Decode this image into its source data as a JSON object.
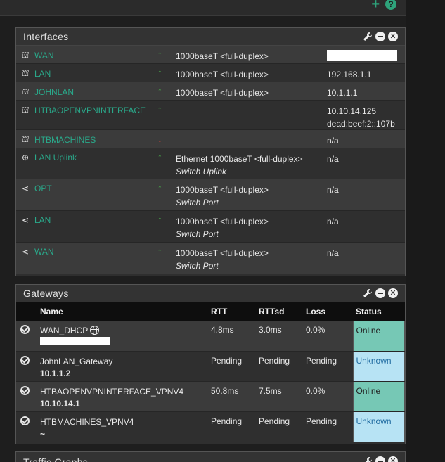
{
  "interfaces": {
    "title": "Interfaces",
    "rows": [
      {
        "name": "WAN",
        "icon": "network-icon",
        "status": "up",
        "media": "1000baseT <full-duplex>",
        "media_sub": "",
        "ip": "",
        "ip2": "",
        "ip_redacted": true
      },
      {
        "name": "LAN",
        "icon": "network-icon",
        "status": "up",
        "media": "1000baseT <full-duplex>",
        "media_sub": "",
        "ip": "192.168.1.1",
        "ip2": ""
      },
      {
        "name": "JOHNLAN",
        "icon": "network-icon",
        "status": "up",
        "media": "1000baseT <full-duplex>",
        "media_sub": "",
        "ip": "10.1.1.1",
        "ip2": ""
      },
      {
        "name": "HTBAOPENVPNINTERFACE",
        "icon": "network-icon",
        "status": "up",
        "media": "",
        "media_sub": "",
        "ip": "10.10.14.125",
        "ip2": "dead:beef:2::107b"
      },
      {
        "name": "HTBMACHINES",
        "icon": "network-icon",
        "status": "down",
        "media": "",
        "media_sub": "",
        "ip": "n/a",
        "ip2": ""
      },
      {
        "name": "LAN Uplink",
        "icon": "crosshair-icon",
        "status": "up",
        "media": "Ethernet 1000baseT <full-duplex>",
        "media_sub": "Switch Uplink",
        "ip": "n/a",
        "ip2": ""
      },
      {
        "name": "OPT",
        "icon": "share-icon",
        "status": "up",
        "media": "1000baseT <full-duplex>",
        "media_sub": "Switch Port",
        "ip": "n/a",
        "ip2": ""
      },
      {
        "name": "LAN",
        "icon": "share-icon",
        "status": "up",
        "media": "1000baseT <full-duplex>",
        "media_sub": "Switch Port",
        "ip": "n/a",
        "ip2": ""
      },
      {
        "name": "WAN",
        "icon": "share-icon",
        "status": "up",
        "media": "1000baseT <full-duplex>",
        "media_sub": "Switch Port",
        "ip": "n/a",
        "ip2": ""
      }
    ]
  },
  "gateways": {
    "title": "Gateways",
    "headers": {
      "name": "Name",
      "rtt": "RTT",
      "rttsd": "RTTsd",
      "loss": "Loss",
      "status": "Status"
    },
    "rows": [
      {
        "name": "WAN_DHCP",
        "sub": "",
        "rtt": "4.8ms",
        "rttsd": "3.0ms",
        "loss": "0.0%",
        "status": "Online"
      },
      {
        "name": "JohnLAN_Gateway",
        "sub": "10.1.1.2",
        "rtt": "Pending",
        "rttsd": "Pending",
        "loss": "Pending",
        "status": "Unknown"
      },
      {
        "name": "HTBAOPENVPNINTERFACE_VPNV4",
        "sub": "10.10.14.1",
        "rtt": "50.8ms",
        "rttsd": "7.5ms",
        "loss": "0.0%",
        "status": "Online"
      },
      {
        "name": "HTBMACHINES_VPNV4",
        "sub": "~",
        "rtt": "Pending",
        "rttsd": "Pending",
        "loss": "Pending",
        "status": "Unknown"
      }
    ]
  },
  "traffic": {
    "title": "Traffic Graphs"
  },
  "colors": {
    "accent": "#2aa88a",
    "up": "#49b04a",
    "down": "#e0443a",
    "online": "#76c8b5",
    "unknown": "#b7e3f4"
  }
}
